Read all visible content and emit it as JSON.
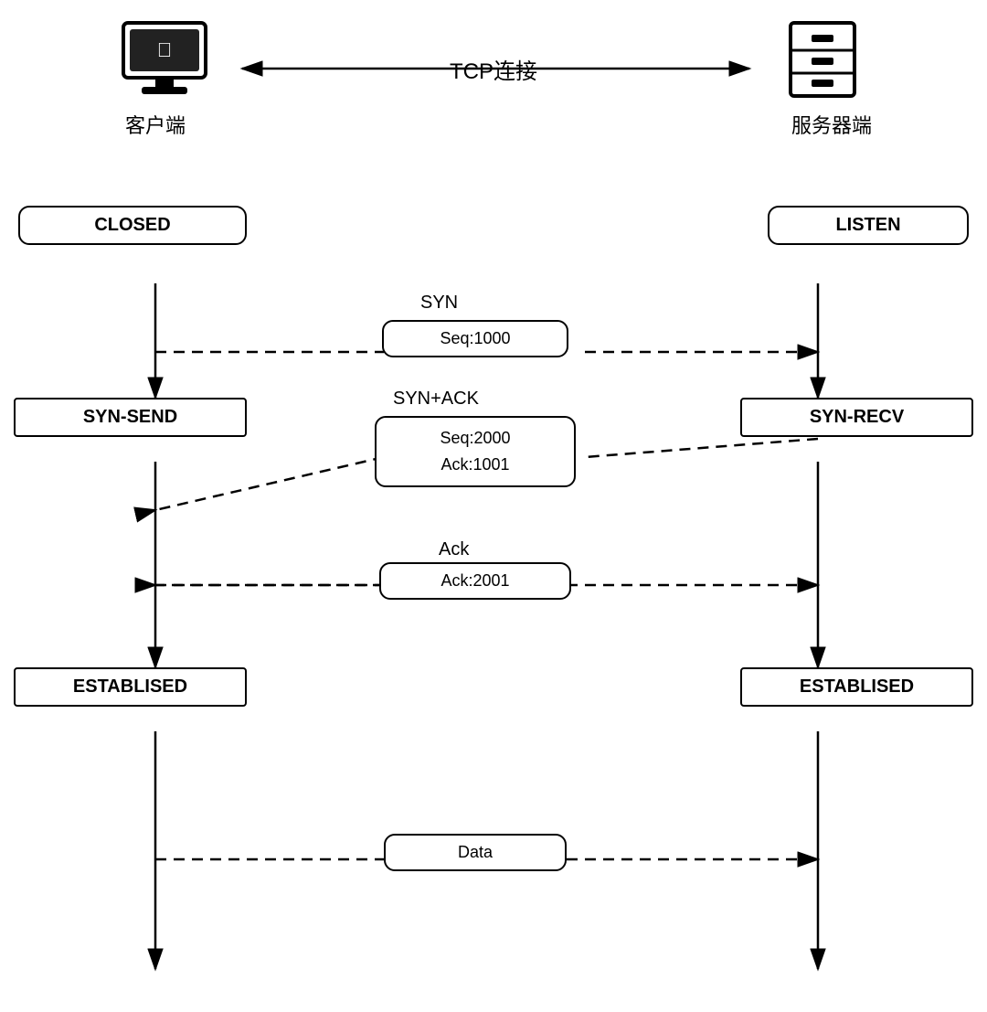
{
  "diagram": {
    "title": "TCP连接",
    "client_label": "客户端",
    "server_label": "服务器端",
    "states": {
      "client_closed": "CLOSED",
      "client_syn_send": "SYN-SEND",
      "client_established": "ESTABLISED",
      "server_listen": "LISTEN",
      "server_syn_recv": "SYN-RECV",
      "server_established": "ESTABLISED"
    },
    "messages": {
      "syn_label": "SYN",
      "syn_box": "Seq:1000",
      "synack_label": "SYN+ACK",
      "synack_box_line1": "Seq:2000",
      "synack_box_line2": "Ack:1001",
      "ack_label": "Ack",
      "ack_box": "Ack:2001",
      "data_box": "Data"
    }
  }
}
